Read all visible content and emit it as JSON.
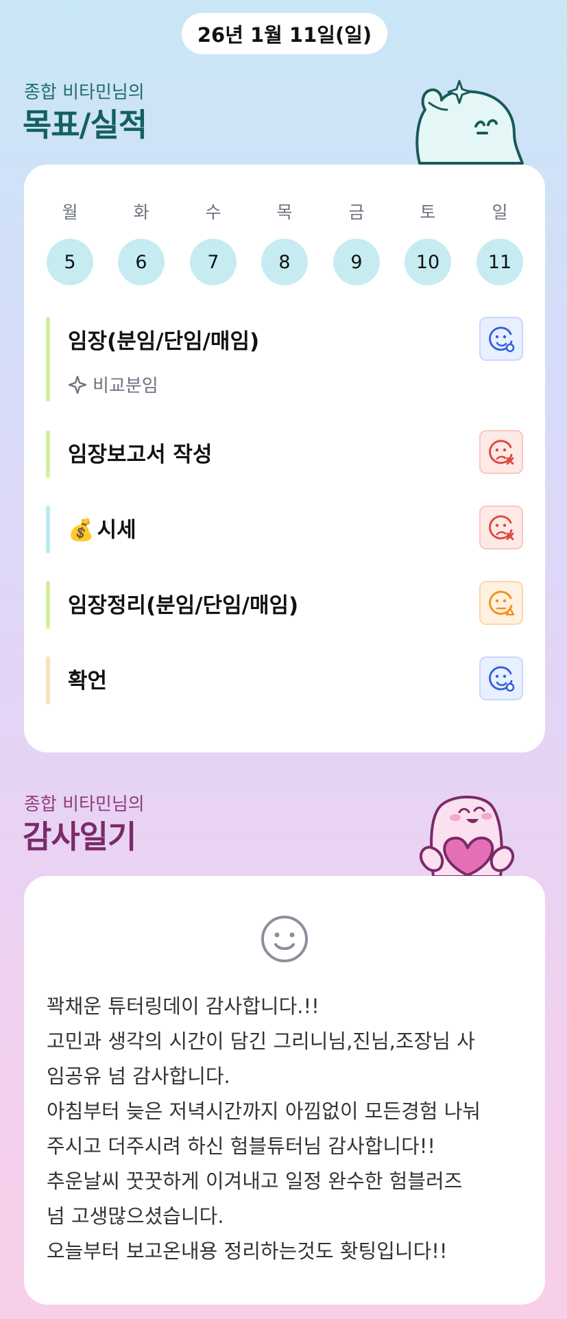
{
  "header": {
    "date": "26년 1월 11일(일)"
  },
  "goals": {
    "subtitle": "종합 비타민님의",
    "title": "목표/실적",
    "colors": {
      "subtitle": "#1f6d6d",
      "title": "#13605f"
    },
    "week": {
      "days": [
        "월",
        "화",
        "수",
        "목",
        "금",
        "토",
        "일"
      ],
      "dates": [
        "5",
        "6",
        "7",
        "8",
        "9",
        "10",
        "11"
      ]
    },
    "tasks": [
      {
        "title": "임장(분임/단임/매임)",
        "sub": "비교분임",
        "bar_color": "#d3f0a2",
        "status": "good"
      },
      {
        "title": "임장보고서 작성",
        "bar_color": "#d3f0a2",
        "status": "bad"
      },
      {
        "title": "시세",
        "emoji": "💰",
        "bar_color": "#bfeaf2",
        "status": "bad"
      },
      {
        "title": "임장정리(분임/단임/매임)",
        "bar_color": "#d3f0a2",
        "status": "mid"
      },
      {
        "title": "확언",
        "bar_color": "#fde0be",
        "status": "good"
      }
    ]
  },
  "gratitude": {
    "subtitle": "종합 비타민님의",
    "title": "감사일기",
    "colors": {
      "subtitle": "#8e3c7c",
      "title": "#7a2a69"
    },
    "lines": [
      "꽉채운 튜터링데이 감사합니다.!!",
      "고민과 생각의 시간이 담긴 그리니님,진님,조장님 사",
      "임공유 넘 감사합니다.",
      "아침부터 늦은 저녁시간까지 아낌없이 모든경험 나눠",
      "주시고 더주시려 하신 험블튜터님 감사합니다!!",
      "추운날씨 꿋꿋하게 이겨내고 일정 완수한 험블러즈",
      "넘 고생많으셨습니다.",
      "오늘부터 보고온내용 정리하는것도 홧팅입니다!!"
    ]
  }
}
